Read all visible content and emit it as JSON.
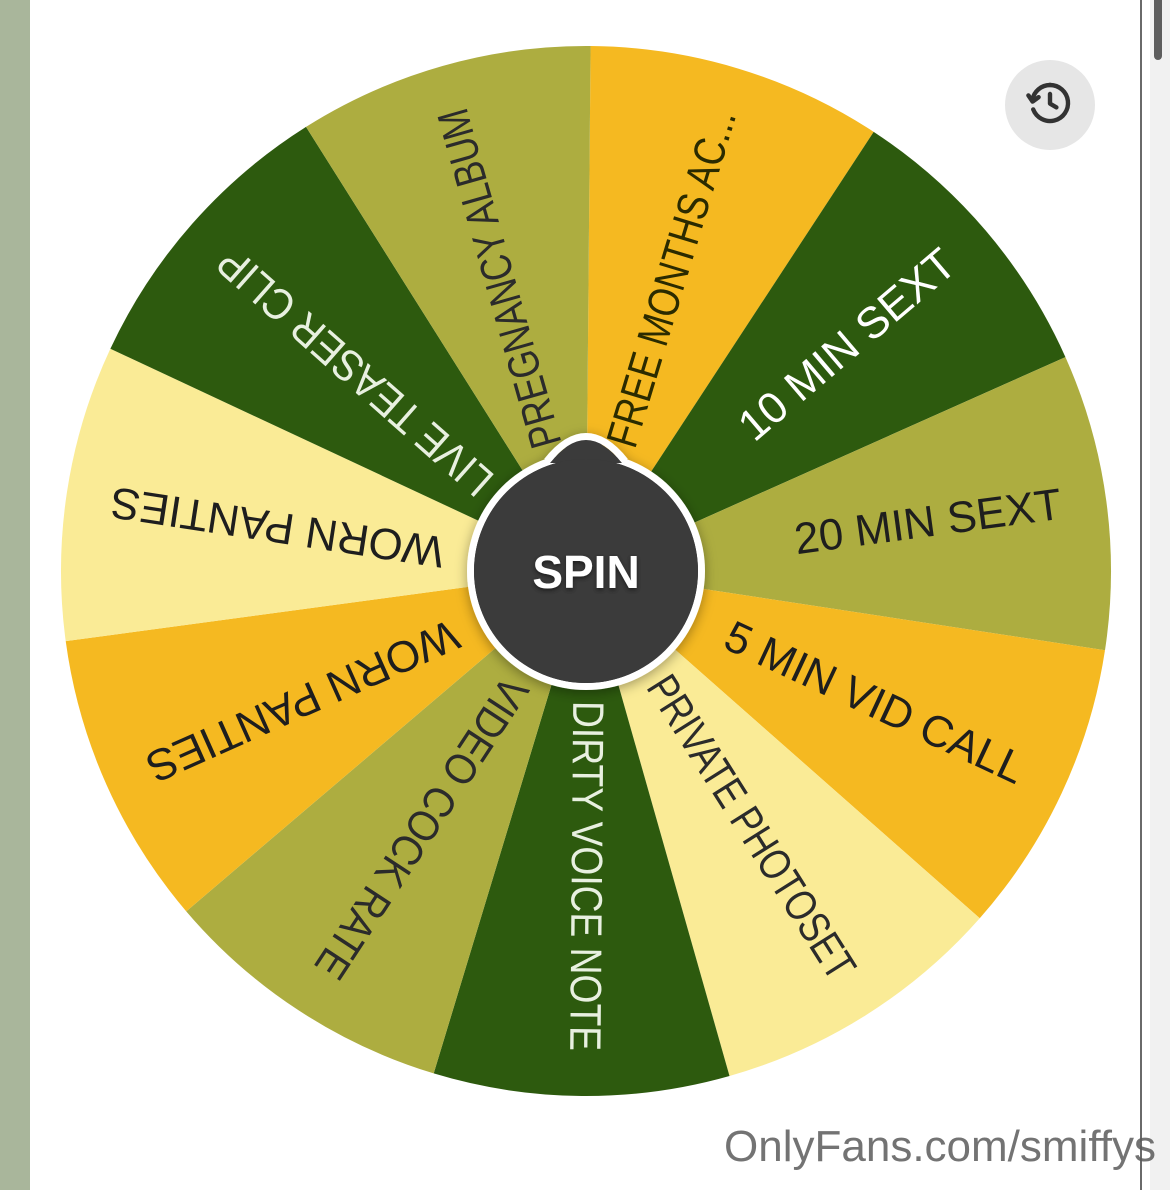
{
  "wheel": {
    "spin_label": "SPIN",
    "segments": [
      {
        "label": "FREE MONTHS AC...",
        "color": "#f5b921",
        "text_color": "#2b2b00"
      },
      {
        "label": "10 MIN SEXT",
        "color": "#2d5a0e",
        "text_color": "#ffffff"
      },
      {
        "label": "20 MIN SEXT",
        "color": "#adad40",
        "text_color": "#1e1e1e"
      },
      {
        "label": "5 MIN VID CALL",
        "color": "#f5b921",
        "text_color": "#1e1e1e"
      },
      {
        "label": "PRIVATE PHOTOSET",
        "color": "#faeb96",
        "text_color": "#2b2b2b"
      },
      {
        "label": "DIRTY VOICE NOTE",
        "color": "#2d5a0e",
        "text_color": "#e8f0e0"
      },
      {
        "label": "VIDEO COCK RATE",
        "color": "#adad40",
        "text_color": "#2b2b2b"
      },
      {
        "label": "WORN PANTIES",
        "color": "#f5b921",
        "text_color": "#1e1e1e"
      },
      {
        "label": "WORN PANTIES",
        "color": "#faeb96",
        "text_color": "#1e1e1e"
      },
      {
        "label": "LIVE TEASER CLIP",
        "color": "#2d5a0e",
        "text_color": "#e8f0e0"
      },
      {
        "label": "PREGNANCY ALBUM",
        "color": "#adad40",
        "text_color": "#2b2b2b"
      }
    ]
  },
  "history_button": {
    "icon": "history-icon"
  },
  "watermark": "OnlyFans.com/smiffys",
  "colors": {
    "hub": "#3a3a3a",
    "hub_border": "#ffffff",
    "background": "#a9b69b"
  }
}
